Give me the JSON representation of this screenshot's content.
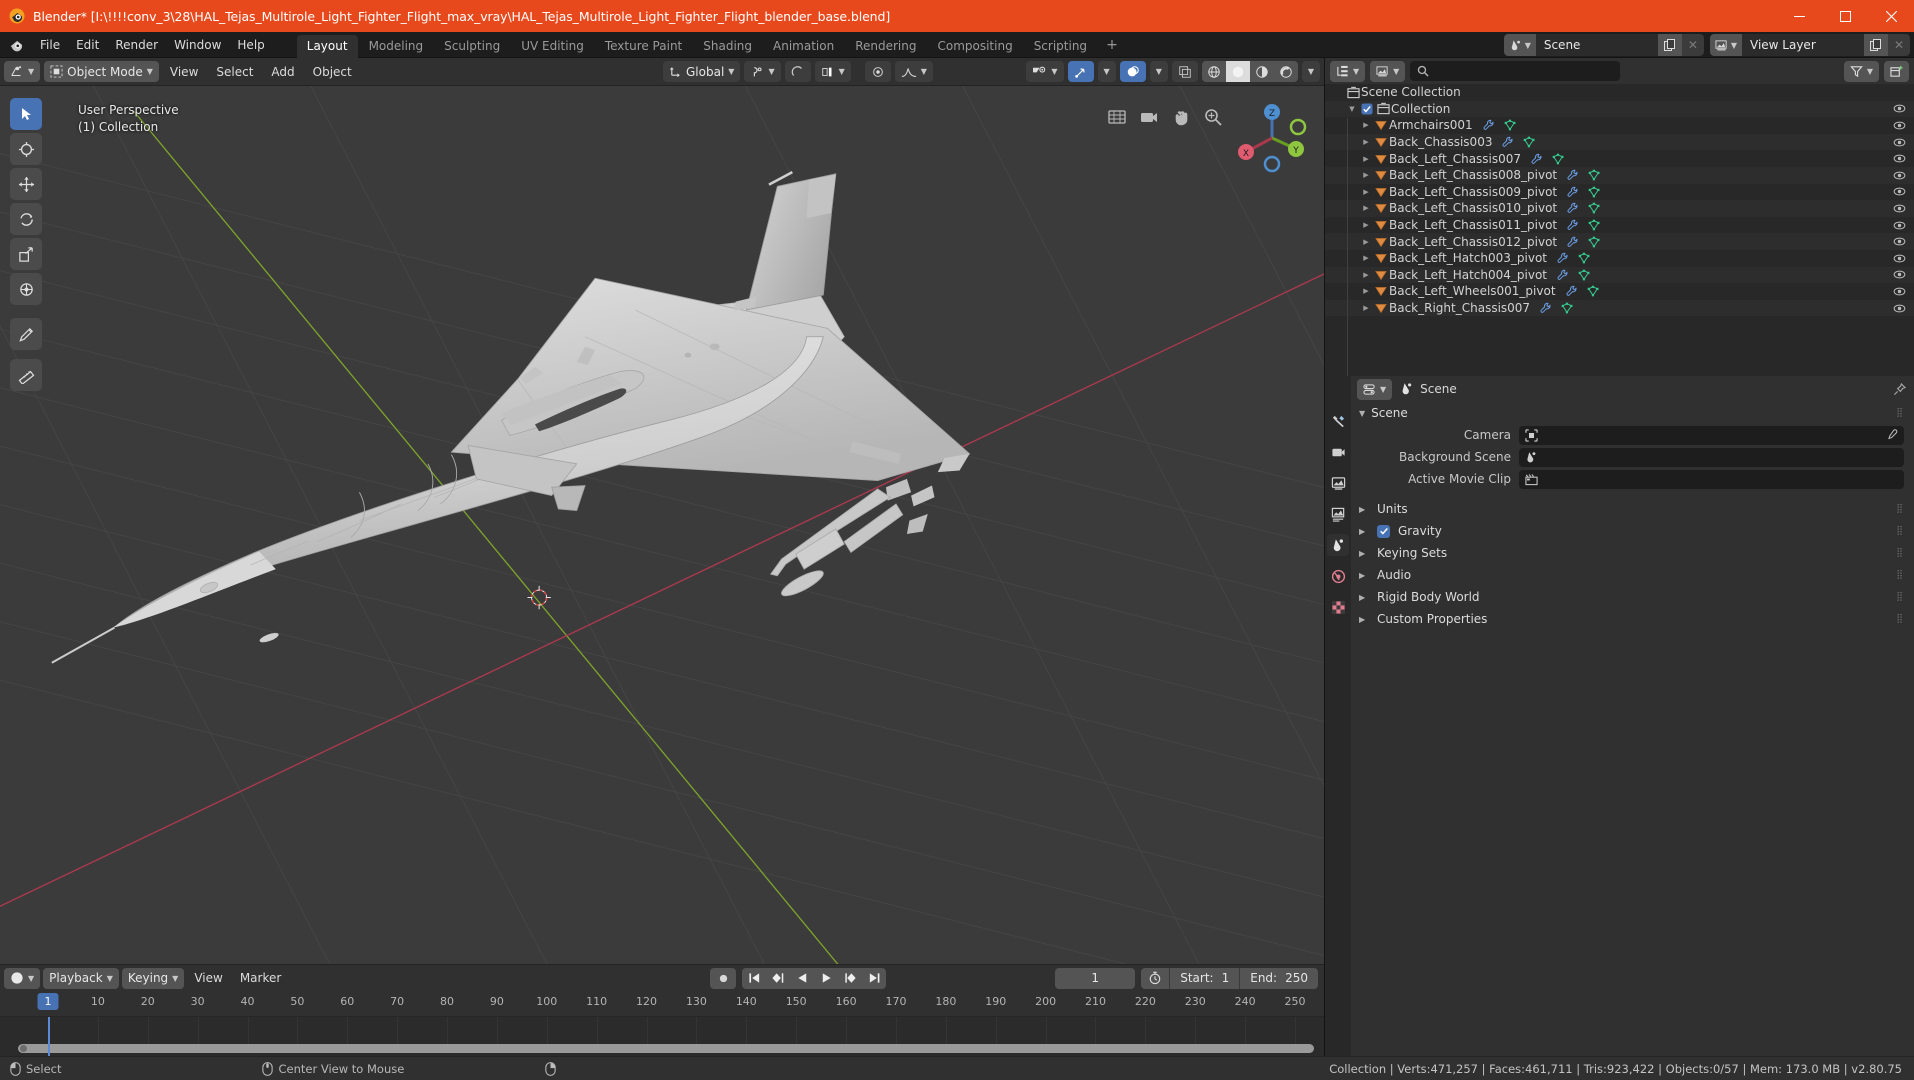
{
  "window": {
    "title": "Blender* [I:\\!!!!conv_3\\28\\HAL_Tejas_Multirole_Light_Fighter_Flight_max_vray\\HAL_Tejas_Multirole_Light_Fighter_Flight_blender_base.blend]",
    "minimize": "—",
    "maximize": "☐",
    "close": "✕",
    "titlebar_color": "#e8491c"
  },
  "topbar": {
    "menus": [
      "File",
      "Edit",
      "Render",
      "Window",
      "Help"
    ],
    "workspaces": [
      {
        "label": "Layout",
        "active": true
      },
      {
        "label": "Modeling",
        "active": false
      },
      {
        "label": "Sculpting",
        "active": false
      },
      {
        "label": "UV Editing",
        "active": false
      },
      {
        "label": "Texture Paint",
        "active": false
      },
      {
        "label": "Shading",
        "active": false
      },
      {
        "label": "Animation",
        "active": false
      },
      {
        "label": "Rendering",
        "active": false
      },
      {
        "label": "Compositing",
        "active": false
      },
      {
        "label": "Scripting",
        "active": false
      }
    ],
    "add_workspace": "+",
    "scene_name": "Scene",
    "view_layer_name": "View Layer"
  },
  "viewport": {
    "mode": "Object Mode",
    "menus": [
      "View",
      "Select",
      "Add",
      "Object"
    ],
    "transform_orientation": "Global",
    "overlay_line1": "User Perspective",
    "overlay_line2": "(1) Collection",
    "gizmo_axes": {
      "x": "X",
      "y": "Y",
      "z": "Z"
    },
    "background_color": "#3b3b3b",
    "grid_color": "#4a4a4a",
    "axis_x_color": "#cc3355",
    "axis_y_color": "#8ebb2d",
    "model_color": "#c9c9c9"
  },
  "timeline": {
    "editor_menus": [
      "Playback",
      "Keying",
      "View",
      "Marker"
    ],
    "current_frame": "1",
    "start_label": "Start:",
    "start_value": "1",
    "end_label": "End:",
    "end_value": "250",
    "ticks": [
      "1",
      "10",
      "20",
      "30",
      "40",
      "50",
      "60",
      "70",
      "80",
      "90",
      "100",
      "110",
      "120",
      "130",
      "140",
      "150",
      "160",
      "170",
      "180",
      "190",
      "200",
      "210",
      "220",
      "230",
      "240",
      "250"
    ],
    "playhead_frame": "1"
  },
  "outliner": {
    "search_placeholder": "",
    "scene_collection": "Scene Collection",
    "collection": "Collection",
    "items": [
      {
        "label": "Armchairs001",
        "indent": 2
      },
      {
        "label": "Back_Chassis003",
        "indent": 2
      },
      {
        "label": "Back_Left_Chassis007",
        "indent": 2
      },
      {
        "label": "Back_Left_Chassis008_pivot",
        "indent": 2
      },
      {
        "label": "Back_Left_Chassis009_pivot",
        "indent": 2
      },
      {
        "label": "Back_Left_Chassis010_pivot",
        "indent": 2
      },
      {
        "label": "Back_Left_Chassis011_pivot",
        "indent": 2
      },
      {
        "label": "Back_Left_Chassis012_pivot",
        "indent": 2
      },
      {
        "label": "Back_Left_Hatch003_pivot",
        "indent": 2
      },
      {
        "label": "Back_Left_Hatch004_pivot",
        "indent": 2
      },
      {
        "label": "Back_Left_Wheels001_pivot",
        "indent": 2
      },
      {
        "label": "Back_Right_Chassis007",
        "indent": 2
      }
    ]
  },
  "properties": {
    "breadcrumb_scene": "Scene",
    "panel_scene": "Scene",
    "rows": [
      {
        "label": "Camera",
        "value": ""
      },
      {
        "label": "Background Scene",
        "value": ""
      },
      {
        "label": "Active Movie Clip",
        "value": ""
      }
    ],
    "accordions": [
      {
        "label": "Units",
        "checkbox": false
      },
      {
        "label": "Gravity",
        "checkbox": true
      },
      {
        "label": "Keying Sets",
        "checkbox": false
      },
      {
        "label": "Audio",
        "checkbox": false
      },
      {
        "label": "Rigid Body World",
        "checkbox": false
      },
      {
        "label": "Custom Properties",
        "checkbox": false
      }
    ]
  },
  "statusbar": {
    "left_items": [
      {
        "label": "Select"
      },
      {
        "label": "Center View to Mouse"
      },
      {
        "label": ""
      }
    ],
    "stats": "Collection | Verts:471,257 | Faces:461,711 | Tris:923,422 | Objects:0/57 | Mem: 173.0 MB | v2.80.75"
  }
}
